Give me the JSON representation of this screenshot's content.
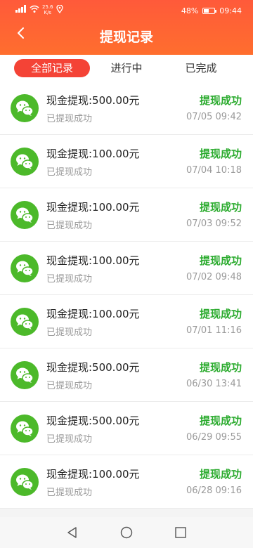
{
  "status_bar": {
    "speed_value": "25.6",
    "speed_unit": "K/s",
    "battery": "48%",
    "battery_level": 0.48,
    "time": "09:44",
    "icons": [
      "signal-icon",
      "wifi-icon",
      "location-icon",
      "battery-icon"
    ]
  },
  "header": {
    "title": "提现记录",
    "back_icon": "chevron-left-icon"
  },
  "tabs": [
    {
      "label": "全部记录",
      "active": true
    },
    {
      "label": "进行中",
      "active": false
    },
    {
      "label": "已完成",
      "active": false
    }
  ],
  "records": [
    {
      "title": "现金提现:500.00元",
      "subtitle": "已提现成功",
      "status": "提现成功",
      "time": "07/05 09:42"
    },
    {
      "title": "现金提现:100.00元",
      "subtitle": "已提现成功",
      "status": "提现成功",
      "time": "07/04 10:18"
    },
    {
      "title": "现金提现:100.00元",
      "subtitle": "已提现成功",
      "status": "提现成功",
      "time": "07/03 09:52"
    },
    {
      "title": "现金提现:100.00元",
      "subtitle": "已提现成功",
      "status": "提现成功",
      "time": "07/02 09:48"
    },
    {
      "title": "现金提现:100.00元",
      "subtitle": "已提现成功",
      "status": "提现成功",
      "time": "07/01 11:16"
    },
    {
      "title": "现金提现:500.00元",
      "subtitle": "已提现成功",
      "status": "提现成功",
      "time": "06/30 13:41"
    },
    {
      "title": "现金提现:500.00元",
      "subtitle": "已提现成功",
      "status": "提现成功",
      "time": "06/29 09:55"
    },
    {
      "title": "现金提现:100.00元",
      "subtitle": "已提现成功",
      "status": "提现成功",
      "time": "06/28 09:16"
    }
  ],
  "colors": {
    "header_start": "#ff5a3a",
    "header_end": "#ff6e2e",
    "active_tab": "#f44336",
    "success": "#2bab2e",
    "wechat": "#4cb92a"
  },
  "navbar": {
    "icons": [
      "back-triangle-icon",
      "home-circle-icon",
      "recents-square-icon"
    ]
  }
}
